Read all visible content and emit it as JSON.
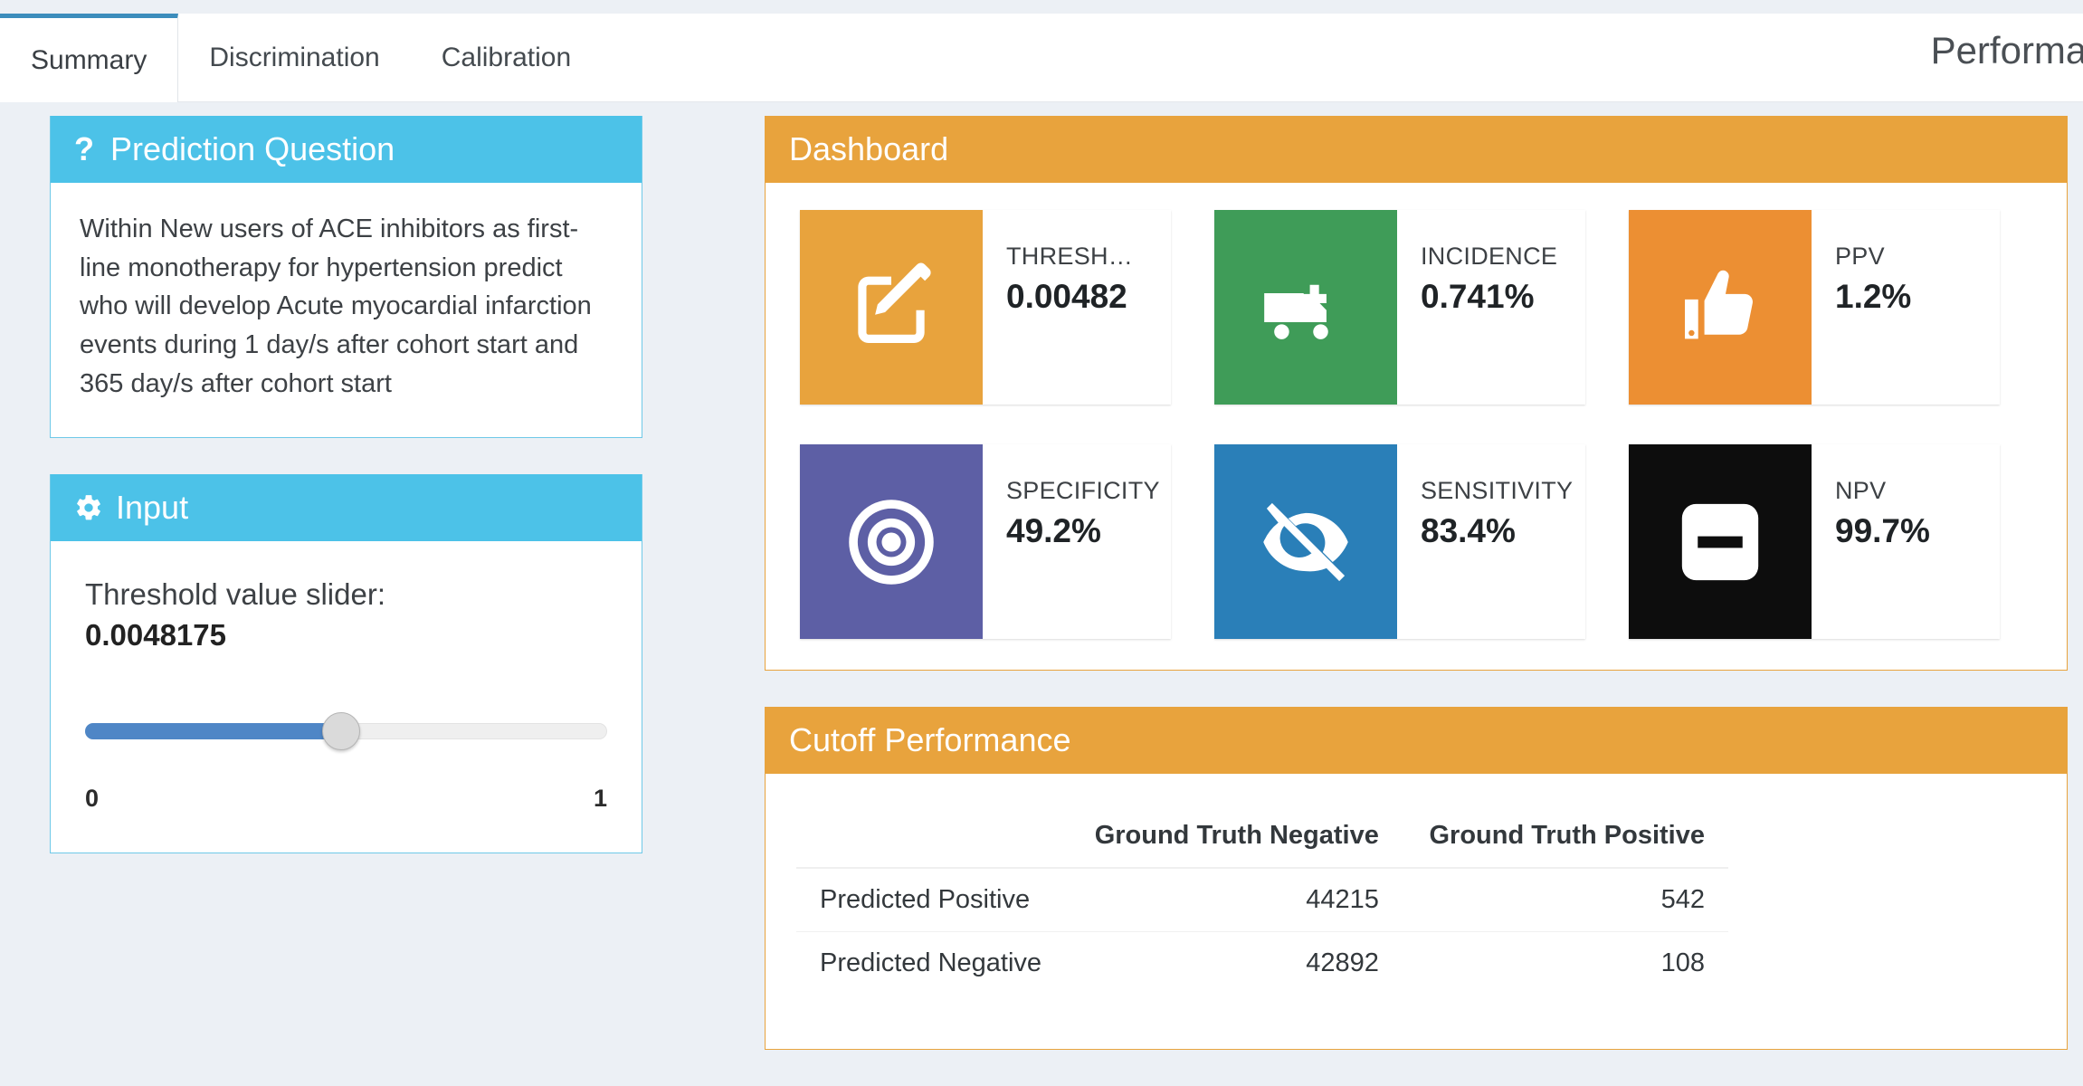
{
  "header": {
    "title": "Performance",
    "tabs": [
      {
        "label": "Summary",
        "active": true
      },
      {
        "label": "Discrimination",
        "active": false
      },
      {
        "label": "Calibration",
        "active": false
      }
    ]
  },
  "prediction_question": {
    "panel_title": "Prediction Question",
    "icon": "question-mark-icon",
    "text": "Within New users of ACE inhibitors as first-line monotherapy for hypertension predict who will develop Acute myocardial infarction events during 1 day/s after cohort start and 365 day/s after cohort start"
  },
  "input": {
    "panel_title": "Input",
    "icon": "gear-icon",
    "slider_label": "Threshold value slider:",
    "slider_value": "0.0048175",
    "slider_min": "0",
    "slider_max": "1",
    "slider_percent": 49
  },
  "dashboard": {
    "panel_title": "Dashboard",
    "tiles": [
      {
        "label": "THRESH…",
        "value": "0.00482",
        "color": "#e8a33d",
        "icon": "edit-pencil-icon"
      },
      {
        "label": "INCIDENCE",
        "value": "0.741%",
        "color": "#3f9c58",
        "icon": "ambulance-icon"
      },
      {
        "label": "PPV",
        "value": "1.2%",
        "color": "#ec8f33",
        "icon": "thumbs-up-icon"
      },
      {
        "label": "SPECIFICITY",
        "value": "49.2%",
        "color": "#5d5fa5",
        "icon": "bullseye-icon"
      },
      {
        "label": "SENSITIVITY",
        "value": "83.4%",
        "color": "#2a7fb8",
        "icon": "eye-slash-icon"
      },
      {
        "label": "NPV",
        "value": "99.7%",
        "color": "#0d0d0d",
        "icon": "minus-square-icon"
      }
    ]
  },
  "cutoff_performance": {
    "panel_title": "Cutoff Performance",
    "columns": [
      "",
      "Ground Truth Negative",
      "Ground Truth Positive"
    ],
    "rows": [
      {
        "label": "Predicted Positive",
        "negative": "44215",
        "positive": "542"
      },
      {
        "label": "Predicted Negative",
        "negative": "42892",
        "positive": "108"
      }
    ]
  },
  "colors": {
    "page_bg": "#ecf0f5",
    "accent_blue": "#4cc2e8",
    "accent_orange": "#e8a33d",
    "tab_active_border": "#3c8dbc",
    "slider_fill": "#4f86c6"
  }
}
